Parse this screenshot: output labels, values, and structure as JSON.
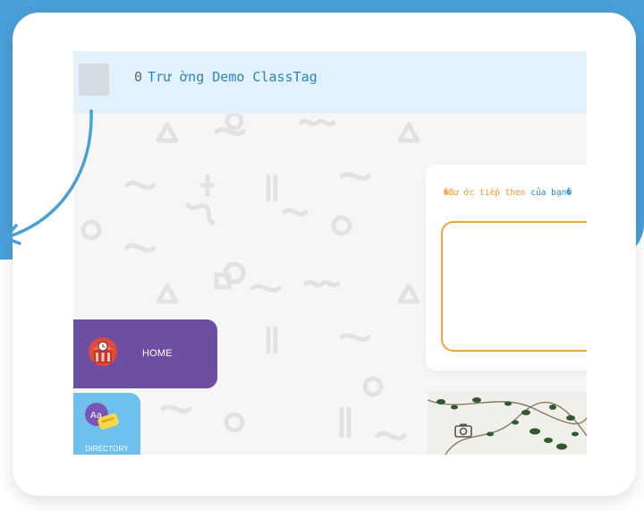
{
  "header": {
    "index": "0",
    "school_name": "Trư ờng Demo ClassTag"
  },
  "next_steps": {
    "heading_prefix": "�Bư ớc tiếp theo",
    "heading_suffix": "của bạn�"
  },
  "nav": {
    "home_label": "HOME",
    "directory_label": "DIRECTORY"
  },
  "colors": {
    "backdrop_blue": "#4a9fd8",
    "header_bg": "#e2f1fb",
    "title_blue": "#2b84c9",
    "home_purple": "#6c4ea3",
    "directory_blue": "#6ec1ee",
    "accent_orange": "#efa73b"
  },
  "icons": {
    "home": "school-building-clock-icon",
    "directory": "contacts-card-icon",
    "photo": "camera-icon",
    "annotation": "curved-arrow-icon"
  }
}
